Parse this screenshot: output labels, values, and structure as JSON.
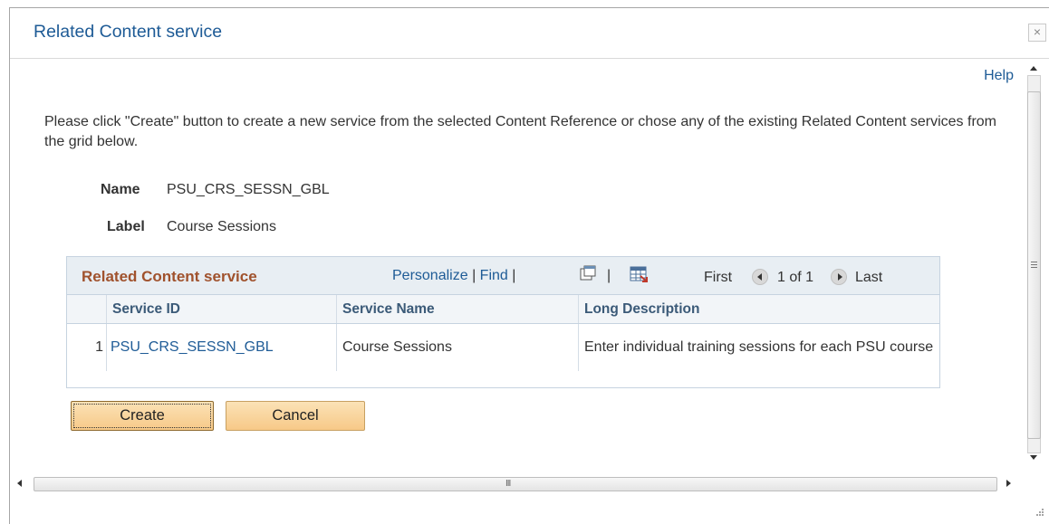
{
  "dialog": {
    "title": "Related Content service",
    "close_label": "×"
  },
  "help_label": "Help",
  "instructions": "Please click \"Create\" button  to create a new service from the selected Content Reference or chose any of the existing  Related Content services from the grid below.",
  "fields": {
    "name_label": "Name",
    "name_value": "PSU_CRS_SESSN_GBL",
    "label_label": "Label",
    "label_value": "Course Sessions"
  },
  "grid": {
    "title": "Related Content service",
    "personalize": "Personalize",
    "find": "Find",
    "sep": "|",
    "first": "First",
    "range": "1 of 1",
    "last": "Last",
    "columns": [
      "Service ID",
      "Service Name",
      "Long Description"
    ],
    "rows": [
      {
        "num": "1",
        "service_id": "PSU_CRS_SESSN_GBL",
        "service_name": "Course Sessions",
        "long_description": "Enter individual training sessions for each PSU course"
      }
    ]
  },
  "buttons": {
    "create": "Create",
    "cancel": "Cancel"
  },
  "scrollbar": {
    "h_grip": "III"
  },
  "colors": {
    "link": "#1e5b96",
    "grid_title": "#a0522d",
    "button": "#f7c988"
  }
}
